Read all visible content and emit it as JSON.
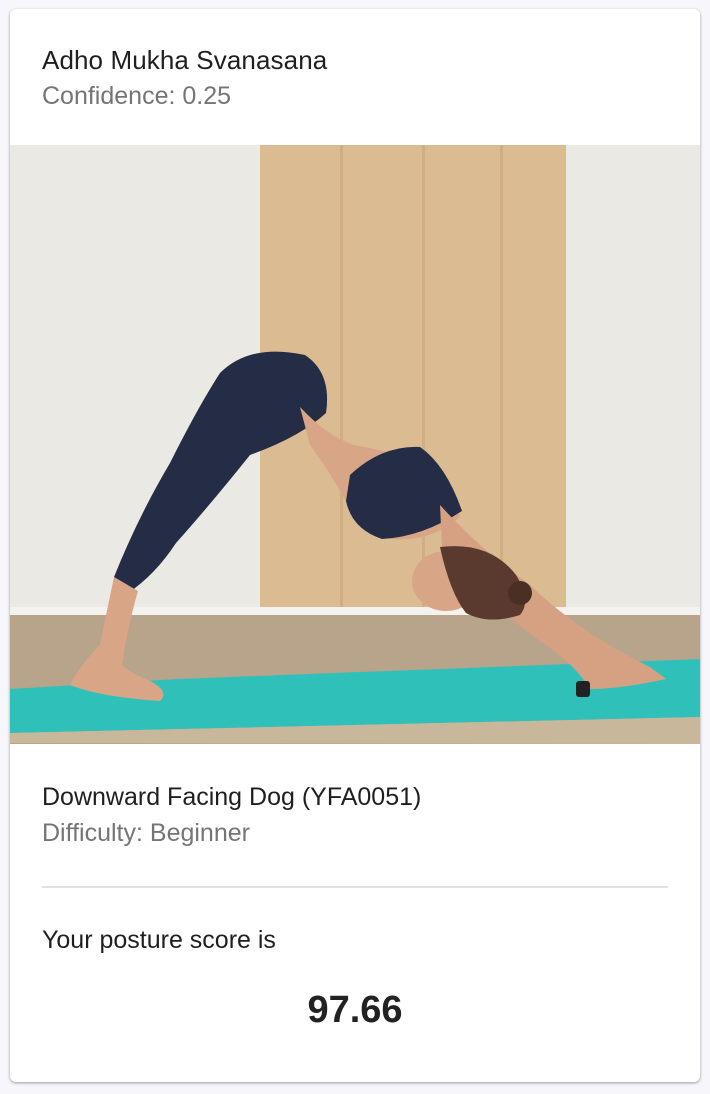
{
  "card": {
    "pose_title": "Adho Mukha Svanasana",
    "confidence_text": "Confidence: 0.25",
    "image_alt": "Woman performing downward facing dog pose on a teal yoga mat",
    "pose_name": "Downward Facing Dog (YFA0051)",
    "difficulty_text": "Difficulty: Beginner",
    "score_label": "Your posture score is",
    "score_value": "97.66"
  },
  "colors": {
    "title_text": "#1f1f1f",
    "secondary_text": "#757575",
    "mat": "#2fc1b9",
    "curtain": "#d9b98f",
    "outfit": "#252c45"
  }
}
